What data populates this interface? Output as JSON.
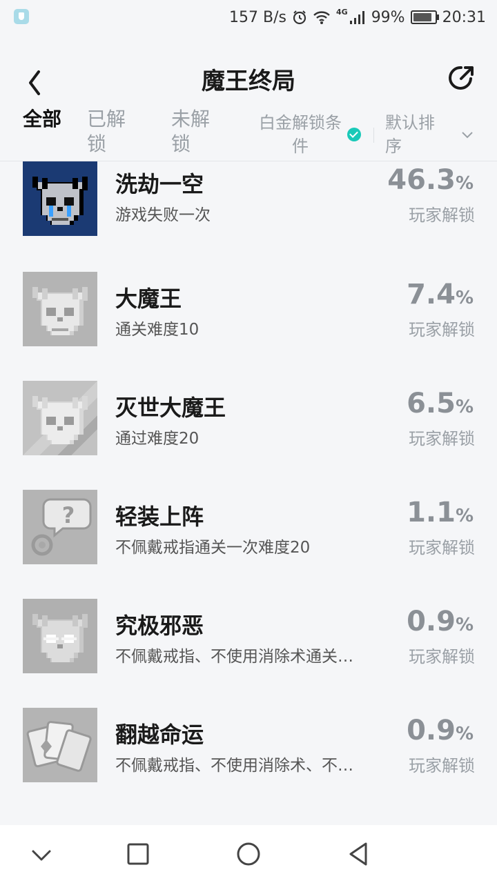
{
  "status_bar": {
    "net_speed": "157 B/s",
    "network": "4G",
    "battery": "99%",
    "time": "20:31"
  },
  "header": {
    "title": "魔王终局"
  },
  "tabs": {
    "all": "全部",
    "unlocked": "已解锁",
    "locked": "未解锁",
    "filter": "白金解锁条件",
    "sort": "默认排序"
  },
  "achievements": [
    {
      "name": "洗劫一空",
      "desc": "游戏失败一次",
      "percent": "46.3",
      "unit": "%",
      "label": "玩家解锁",
      "unlocked": true,
      "icon": "crying-skull-icon"
    },
    {
      "name": "大魔王",
      "desc": "通关难度10",
      "percent": "7.4",
      "unit": "%",
      "label": "玩家解锁",
      "unlocked": false,
      "icon": "horned-skull-icon"
    },
    {
      "name": "灭世大魔王",
      "desc": "通过难度20",
      "percent": "6.5",
      "unit": "%",
      "label": "玩家解锁",
      "unlocked": false,
      "icon": "horned-skull-striped-icon"
    },
    {
      "name": "轻装上阵",
      "desc": "不佩戴戒指通关一次难度20",
      "percent": "1.1",
      "unit": "%",
      "label": "玩家解锁",
      "unlocked": false,
      "icon": "question-ring-icon"
    },
    {
      "name": "究极邪恶",
      "desc": "不佩戴戒指、不使用消除术通关…",
      "percent": "0.9",
      "unit": "%",
      "label": "玩家解锁",
      "unlocked": false,
      "icon": "glowing-skull-icon"
    },
    {
      "name": "翻越命运",
      "desc": "不佩戴戒指、不使用消除术、不…",
      "percent": "0.9",
      "unit": "%",
      "label": "玩家解锁",
      "unlocked": false,
      "icon": "playing-cards-icon"
    }
  ],
  "colors": {
    "accent_check": "#19c9b8",
    "unlocked_bg": "#1b3a73",
    "locked_bg": "#b4b4b4"
  }
}
